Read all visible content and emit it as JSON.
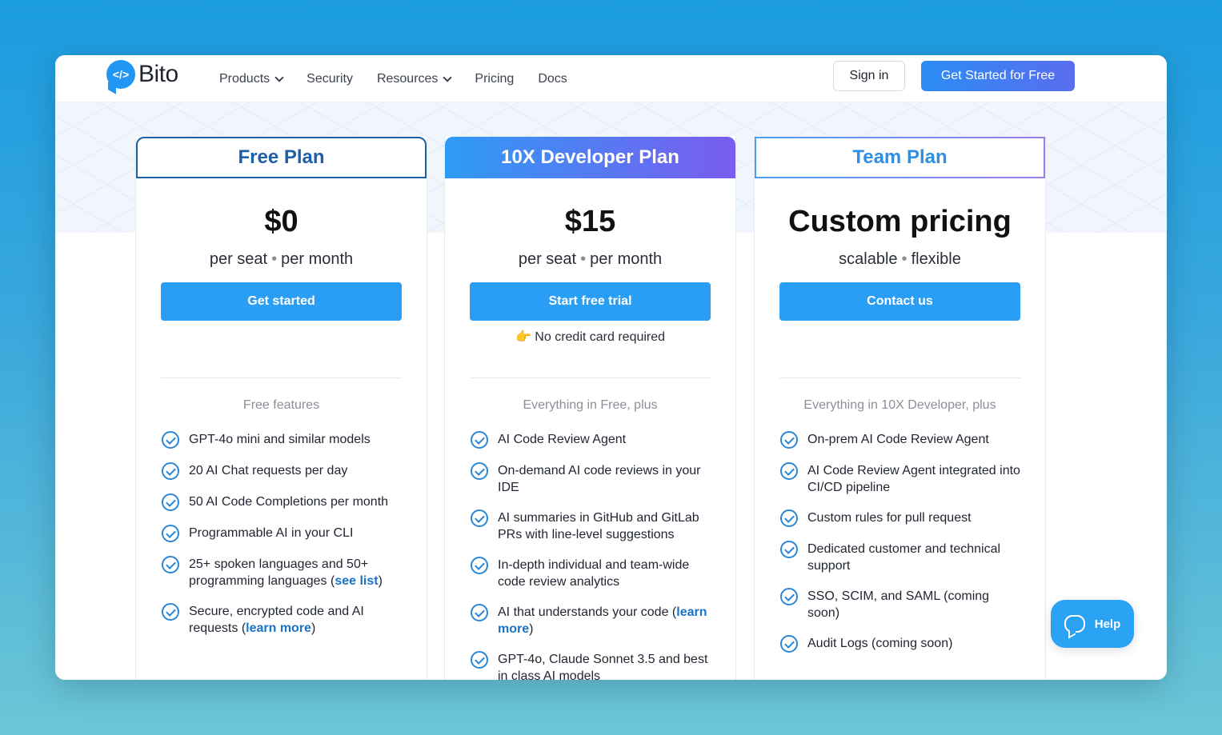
{
  "nav": {
    "logo_text": "Bito",
    "links": [
      {
        "label": "Products",
        "dropdown": true
      },
      {
        "label": "Security",
        "dropdown": false
      },
      {
        "label": "Resources",
        "dropdown": true
      },
      {
        "label": "Pricing",
        "dropdown": false
      },
      {
        "label": "Docs",
        "dropdown": false
      }
    ],
    "sign_in": "Sign in",
    "get_started": "Get Started for Free"
  },
  "plans": [
    {
      "name": "Free Plan",
      "price": "$0",
      "sub_a": "per seat",
      "sub_b": "per month",
      "cta": "Get started",
      "note": "",
      "features_title": "Free features",
      "features": [
        {
          "text": "GPT-4o mini and similar models"
        },
        {
          "text": "20 AI Chat requests per day"
        },
        {
          "text": "50 AI Code Completions per month"
        },
        {
          "text": "Programmable AI in your CLI"
        },
        {
          "text": "25+ spoken languages and 50+ programming languages (",
          "link": "see list",
          "after": ")"
        },
        {
          "text": "Secure, encrypted code and AI requests (",
          "link": "learn more",
          "after": ")"
        }
      ]
    },
    {
      "name": "10X Developer Plan",
      "price": "$15",
      "sub_a": "per seat",
      "sub_b": "per month",
      "cta": "Start free trial",
      "note": "👉 No credit card required",
      "features_title": "Everything in Free, plus",
      "features": [
        {
          "text": "AI Code Review Agent"
        },
        {
          "text": "On-demand AI code reviews in your IDE"
        },
        {
          "text": "AI summaries in GitHub and GitLab PRs with line-level suggestions"
        },
        {
          "text": "In-depth individual and team-wide code review analytics"
        },
        {
          "text": "AI that understands your code (",
          "link": "learn more",
          "after": ")"
        },
        {
          "text": "GPT-4o, Claude Sonnet 3.5 and best in class AI models"
        }
      ]
    },
    {
      "name": "Team Plan",
      "price": "Custom pricing",
      "sub_a": "scalable",
      "sub_b": "flexible",
      "cta": "Contact us",
      "note": "",
      "features_title": "Everything in 10X Developer, plus",
      "features": [
        {
          "text": "On-prem AI Code Review Agent"
        },
        {
          "text": "AI Code Review Agent integrated into CI/CD pipeline"
        },
        {
          "text": "Custom rules for pull request"
        },
        {
          "text": "Dedicated customer and technical support"
        },
        {
          "text": "SSO, SCIM, and SAML (coming soon)"
        },
        {
          "text": "Audit Logs (coming soon)"
        }
      ]
    }
  ],
  "help": {
    "label": "Help"
  },
  "colors": {
    "brand": "#2196f3",
    "cta": "#2a9df4",
    "link": "#1a73c8",
    "check": "#2a86d6"
  }
}
